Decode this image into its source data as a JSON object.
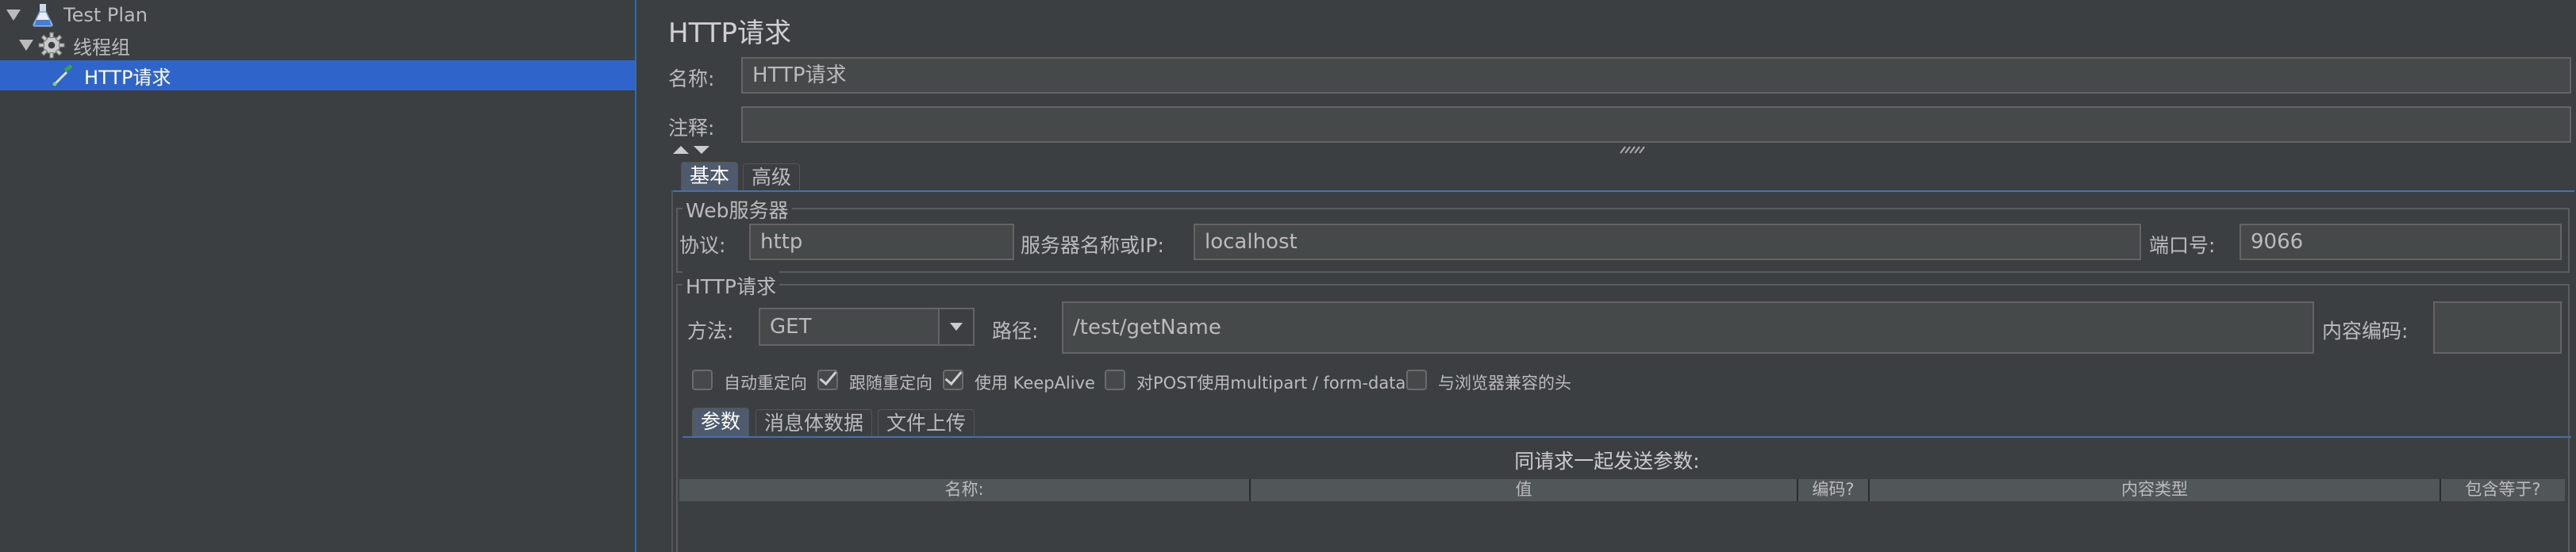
{
  "tree": {
    "items": [
      {
        "label": "Test Plan",
        "icon": "flask-icon"
      },
      {
        "label": "线程组",
        "icon": "gear-icon"
      },
      {
        "label": "HTTP请求",
        "icon": "pipette-icon"
      }
    ]
  },
  "form": {
    "title": "HTTP请求",
    "name_label": "名称:",
    "name_value": "HTTP请求",
    "comment_label": "注释:",
    "comment_value": ""
  },
  "tabs": [
    "基本",
    "高级"
  ],
  "web_server": {
    "legend": "Web服务器",
    "protocol_label": "协议:",
    "protocol_value": "http",
    "server_label": "服务器名称或IP:",
    "server_value": "localhost",
    "port_label": "端口号:",
    "port_value": "9066"
  },
  "http_request": {
    "legend": "HTTP请求",
    "method_label": "方法:",
    "method_value": "GET",
    "path_label": "路径:",
    "path_value": "/test/getName",
    "encoding_label": "内容编码:",
    "encoding_value": ""
  },
  "options": [
    {
      "label": "自动重定向",
      "checked": false
    },
    {
      "label": "跟随重定向",
      "checked": true
    },
    {
      "label": "使用 KeepAlive",
      "checked": true
    },
    {
      "label": "对POST使用multipart / form-data",
      "checked": false
    },
    {
      "label": "与浏览器兼容的头",
      "checked": false
    }
  ],
  "sub_tabs": [
    "参数",
    "消息体数据",
    "文件上传"
  ],
  "params": {
    "caption": "同请求一起发送参数:",
    "columns": [
      "名称:",
      "值",
      "编码?",
      "内容类型",
      "包含等于?"
    ]
  },
  "colors": {
    "background": "#3c3f41",
    "selection": "#2f65ca",
    "field": "#45494a",
    "tab_active": "#4e5a6e"
  }
}
